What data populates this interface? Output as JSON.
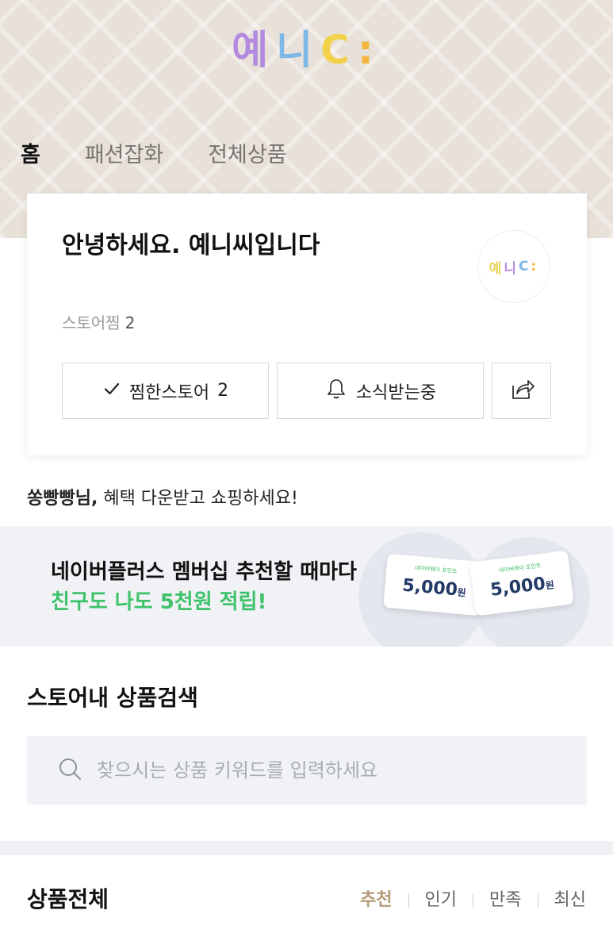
{
  "header": {
    "logo": {
      "letters": [
        "예",
        "니",
        "C",
        ":"
      ],
      "colors": [
        "#b38ae0",
        "#7fb7e6",
        "#f2d24b",
        "#f2b63c"
      ]
    }
  },
  "tabs": [
    {
      "label": "홈",
      "active": true
    },
    {
      "label": "패션잡화",
      "active": false
    },
    {
      "label": "전체상품",
      "active": false
    }
  ],
  "profile": {
    "greeting": "안녕하세요. 예니씨입니다 ",
    "favorite_label": "스토어찜",
    "favorite_count": "2",
    "avatar_logo": {
      "letters": [
        "예",
        "니",
        "C",
        ":"
      ],
      "colors": [
        "#e8d15a",
        "#b38ae0",
        "#7fb7e6",
        "#f2b63c"
      ]
    },
    "buttons": {
      "favorited": {
        "label": "찜한스토어",
        "count": "2",
        "icon": "check-icon"
      },
      "notify": {
        "label": "소식받는중",
        "icon": "bell-icon"
      },
      "share": {
        "icon": "share-icon"
      }
    }
  },
  "benefit": {
    "user": "쏭빵빵님,",
    "text": "혜택 다운받고 쇼핑하세요!"
  },
  "banner": {
    "line1": "네이버플러스 멤버십 추천할 때마다",
    "line2": "친구도 나도 5천원 적립!",
    "coupons": [
      {
        "caption": "네이버페이 포인트",
        "amount": "5,000",
        "unit": "원"
      },
      {
        "caption": "네이버페이 포인트",
        "amount": "5,000",
        "unit": "원"
      }
    ]
  },
  "search": {
    "title": "스토어내 상품검색",
    "placeholder": "찾으시는 상품 키워드를 입력하세요",
    "value": ""
  },
  "products": {
    "title": "상품전체",
    "sort_options": [
      {
        "label": "추천",
        "active": true
      },
      {
        "label": "인기",
        "active": false
      },
      {
        "label": "만족",
        "active": false
      },
      {
        "label": "최신",
        "active": false
      }
    ]
  },
  "colors": {
    "accent_green": "#3ec26b",
    "sort_active": "#b59b7a",
    "hero_bg": "#e8e1d9"
  }
}
